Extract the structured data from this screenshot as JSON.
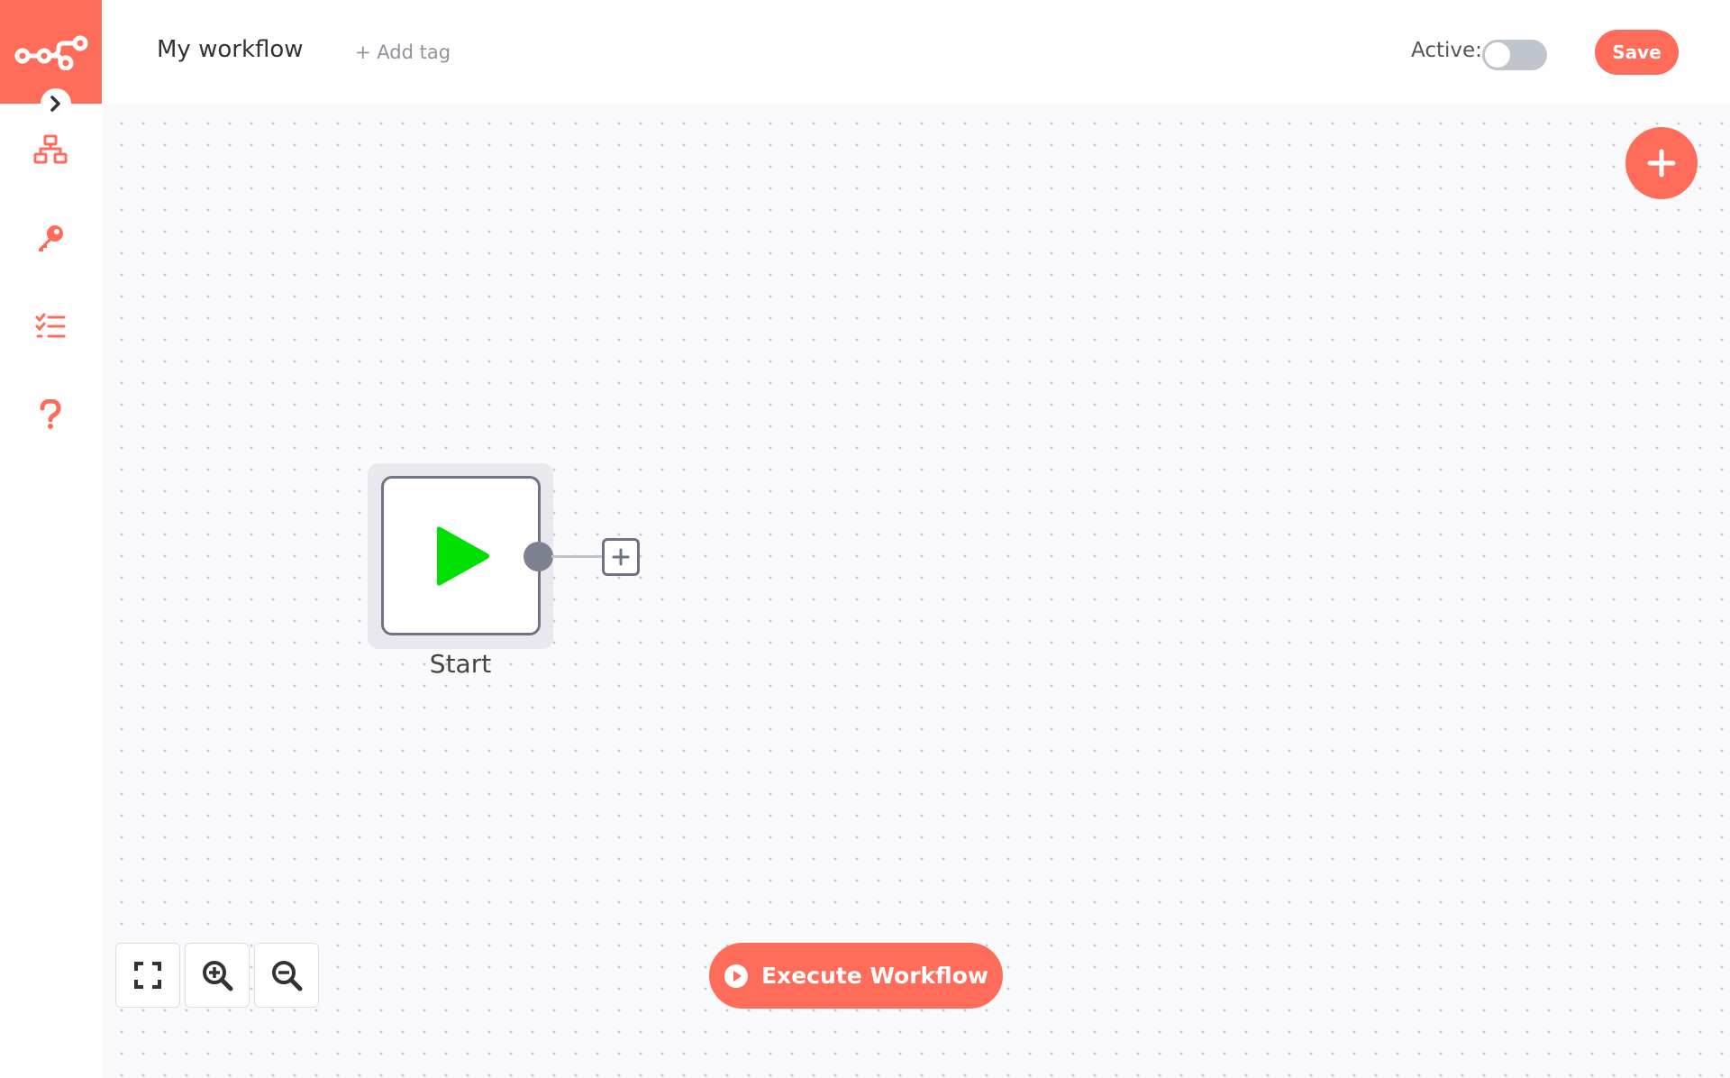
{
  "header": {
    "workflow_name": "My workflow",
    "add_tag": "+ Add tag",
    "active_label": "Active:",
    "active": false,
    "save_label": "Save"
  },
  "sidebar": {
    "icons": [
      "network-icon",
      "key-icon",
      "list-check-icon",
      "question-icon"
    ]
  },
  "canvas": {
    "node": {
      "label": "Start",
      "icon": "play-icon"
    },
    "execute_label": "Execute Workflow",
    "zoom_controls": [
      "fullscreen-icon",
      "zoom-in-icon",
      "zoom-out-icon"
    ]
  },
  "colors": {
    "accent": "#ff6d5a",
    "play": "#00e000",
    "toggle_off": "#c0c4cc"
  }
}
